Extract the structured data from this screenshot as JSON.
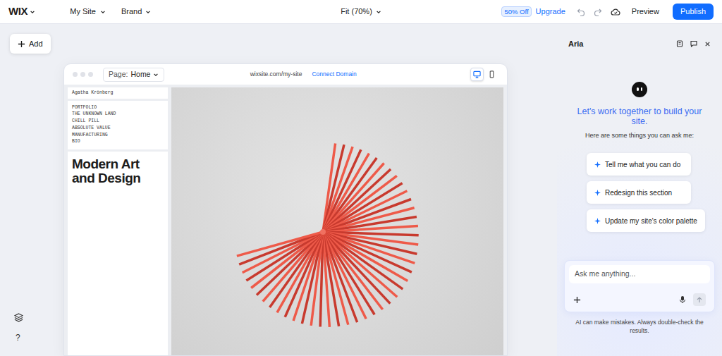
{
  "topbar": {
    "logo": "WIX",
    "site_menu": "My Site",
    "brand_menu": "Brand",
    "zoom": "Fit (70%)",
    "discount_badge": "50% Off",
    "upgrade": "Upgrade",
    "preview": "Preview",
    "publish": "Publish"
  },
  "left_rail": {
    "add": "Add",
    "help": "?"
  },
  "browser": {
    "page_label": "Page:",
    "page_name": "Home",
    "url": "wixsite.com/my-site",
    "connect_domain": "Connect Domain",
    "devices": [
      {
        "kind": "desktop",
        "selected": true
      },
      {
        "kind": "mobile",
        "selected": false
      }
    ]
  },
  "site": {
    "owner": "Agatha Krönberg",
    "menu": [
      "PORTFOLIO",
      "THE UNKNOWN LAND",
      "CHILL PILL",
      "ABSOLUTE VALUE",
      "MANUFACTURING",
      "BIO"
    ],
    "heading": "Modern Art and Design"
  },
  "assistant": {
    "title": "Aria",
    "headline": "Let's work together to build your site.",
    "intro": "Here are some things you can ask me:",
    "suggestions": [
      "Tell me what you can do",
      "Redesign this section",
      "Update my site's color palette"
    ],
    "input_placeholder": "Ask me anything...",
    "disclaimer": "AI can make mistakes. Always double-check the results."
  }
}
